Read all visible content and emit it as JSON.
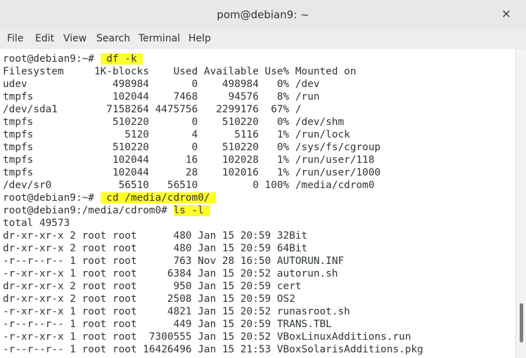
{
  "window": {
    "title": "pom@debian9: ~",
    "close_glyph": "×"
  },
  "menu": [
    "File",
    "Edit",
    "View",
    "Search",
    "Terminal",
    "Help"
  ],
  "terminal": {
    "lines": [
      {
        "text": "              -------- ---  ---- -- ------- -- --- -------"
      },
      {
        "prompt": "root@debian9:~# ",
        "cmd": " df -k "
      },
      {
        "text": "Filesystem     1K-blocks    Used Available Use% Mounted on"
      },
      {
        "text": "udev              498984       0    498984   0% /dev"
      },
      {
        "text": "tmpfs             102044    7468     94576   8% /run"
      },
      {
        "text": "/dev/sda1        7158264 4475756   2299176  67% /"
      },
      {
        "text": "tmpfs             510220       0    510220   0% /dev/shm"
      },
      {
        "text": "tmpfs               5120       4      5116   1% /run/lock"
      },
      {
        "text": "tmpfs             510220       0    510220   0% /sys/fs/cgroup"
      },
      {
        "text": "tmpfs             102044      16    102028   1% /run/user/118"
      },
      {
        "text": "tmpfs             102044      28    102016   1% /run/user/1000"
      },
      {
        "text": "/dev/sr0           56510   56510         0 100% /media/cdrom0"
      },
      {
        "prompt": "root@debian9:~# ",
        "cmd": " cd /media/cdrom0/ "
      },
      {
        "prompt": "root@debian9:/media/cdrom0# ",
        "cmd": "ls -l "
      },
      {
        "text": "total 49573"
      },
      {
        "text": "dr-xr-xr-x 2 root root      480 Jan 15 20:59 32Bit"
      },
      {
        "text": "dr-xr-xr-x 2 root root      480 Jan 15 20:59 64Bit"
      },
      {
        "text": "-r--r--r-- 1 root root      763 Nov 28 16:50 AUTORUN.INF"
      },
      {
        "text": "-r-xr-xr-x 1 root root     6384 Jan 15 20:52 autorun.sh"
      },
      {
        "text": "dr-xr-xr-x 2 root root      950 Jan 15 20:59 cert"
      },
      {
        "text": "dr-xr-xr-x 2 root root     2508 Jan 15 20:59 OS2"
      },
      {
        "text": "-r-xr-xr-x 1 root root     4821 Jan 15 20:52 runasroot.sh"
      },
      {
        "text": "-r--r--r-- 1 root root      449 Jan 15 20:59 TRANS.TBL"
      },
      {
        "text": "-r-xr-xr-x 1 root root  7300555 Jan 15 20:52 VBoxLinuxAdditions.run"
      },
      {
        "text": "-r--r--r-- 1 root root 16426496 Jan 15 21:53 VBoxSolarisAdditions.pkg"
      }
    ]
  },
  "colors": {
    "highlight": "#ffff2a",
    "text": "#2e3436",
    "terminal_bg": "#ffffff"
  }
}
